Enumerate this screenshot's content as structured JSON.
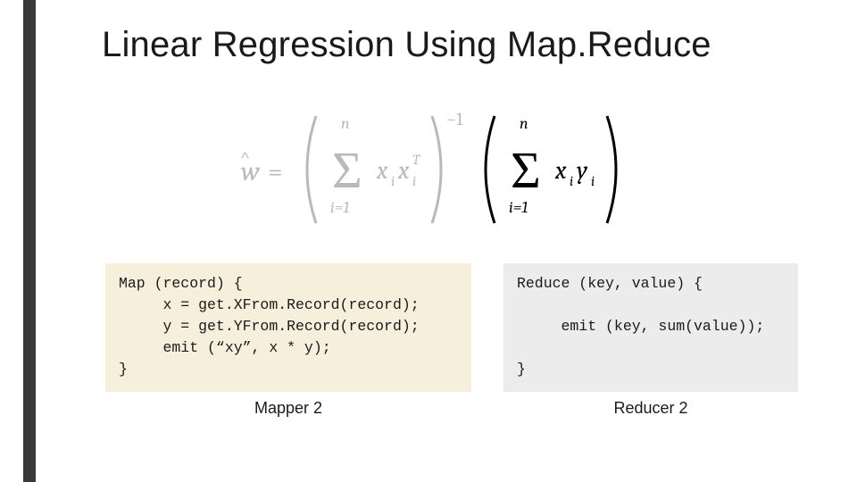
{
  "title": "Linear Regression Using Map.Reduce",
  "formula": {
    "lhs": "ŵ =",
    "sum_lower": "i=1",
    "sum_upper": "n",
    "term1": "xᵢxᵢᵀ",
    "inv": "−1",
    "term2": "xᵢyᵢ"
  },
  "mapper": {
    "code": "Map (record) {\n     x = get.XFrom.Record(record);\n     y = get.YFrom.Record(record);\n     emit (“xy”, x * y);\n}",
    "caption": "Mapper 2"
  },
  "reducer": {
    "code": "Reduce (key, value) {\n\n     emit (key, sum(value));\n\n}",
    "caption": "Reducer 2"
  }
}
